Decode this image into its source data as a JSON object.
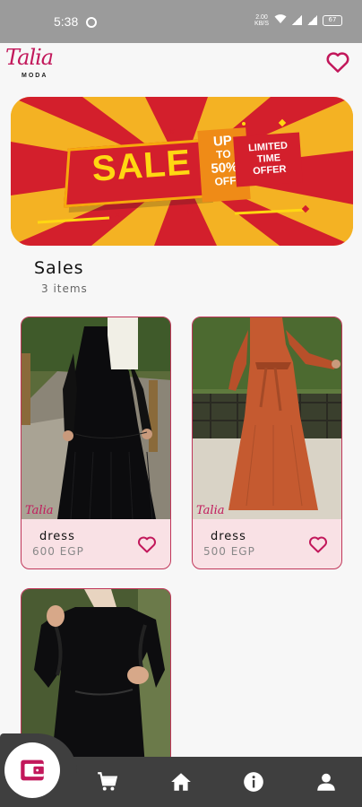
{
  "status_bar": {
    "time": "5:38",
    "net_speed_value": "2.00",
    "net_speed_unit": "KB/S",
    "battery": "67"
  },
  "header": {
    "logo_text": "Talia",
    "logo_sub": "MODA",
    "favorite_icon": "heart-outline-icon"
  },
  "banner": {
    "sale": "SALE",
    "up": "UP",
    "to": "TO",
    "percent": "50%",
    "off": "OFF",
    "limited_line1": "LIMITED",
    "limited_line2": "TIME",
    "limited_line3": "OFFER"
  },
  "section": {
    "title": "Sales",
    "count": "3 items"
  },
  "products": [
    {
      "name": "dress",
      "price": "600 EGP",
      "watermark": "Talia"
    },
    {
      "name": "dress",
      "price": "500 EGP",
      "watermark": "Talia"
    },
    {
      "name": "",
      "price": "",
      "watermark": ""
    }
  ],
  "nav": {
    "items": [
      "wallet-icon",
      "cart-icon",
      "home-icon",
      "info-icon",
      "profile-icon"
    ],
    "active": "wallet-icon"
  },
  "colors": {
    "accent": "#c2185b",
    "card_bg": "#f9e1e5",
    "nav_bg": "#3f3f3f",
    "banner_red": "#d31f2c",
    "banner_yellow": "#f4b223"
  }
}
